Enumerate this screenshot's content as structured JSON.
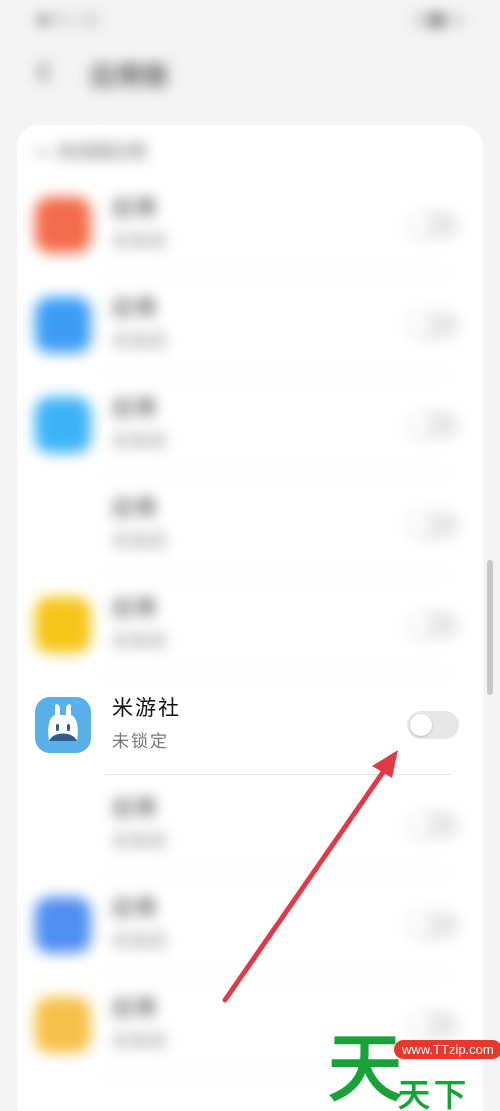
{
  "statusbar": {
    "left_text": "▪ ≈ ◌ ▯",
    "right_text": "▯ ▮▮ ▭"
  },
  "header": {
    "title": "应用锁"
  },
  "section": {
    "label": "← 未加锁应用"
  },
  "apps": [
    {
      "name": "应用",
      "status": "未锁定",
      "color": "#f36b4a",
      "icon": "app-icon",
      "blurred": true
    },
    {
      "name": "应用",
      "status": "未锁定",
      "color": "#3d9df6",
      "icon": "app-icon",
      "blurred": true
    },
    {
      "name": "应用",
      "status": "未锁定",
      "color": "#3db3f7",
      "icon": "app-icon",
      "blurred": true
    },
    {
      "name": "应用",
      "status": "未锁定",
      "color": "#ffffff",
      "icon": "app-icon",
      "blurred": true
    },
    {
      "name": "应用",
      "status": "未锁定",
      "color": "#f5c518",
      "icon": "app-icon",
      "blurred": true
    },
    {
      "name": "米游社",
      "status": "未锁定",
      "color": "#5ab0e9",
      "icon": "miyoushe-icon",
      "blurred": false
    },
    {
      "name": "应用",
      "status": "未锁定",
      "color": "#ffffff",
      "icon": "app-icon",
      "blurred": true
    },
    {
      "name": "应用",
      "status": "未锁定",
      "color": "#4f8ef2",
      "icon": "app-icon",
      "blurred": true
    },
    {
      "name": "应用",
      "status": "未锁定",
      "color": "#f7c04a",
      "icon": "app-icon",
      "blurred": true
    }
  ],
  "watermark": {
    "big_char": "天",
    "url": "www.TTzip.com",
    "small_text": "天下载"
  },
  "colors": {
    "annotation_arrow": "#e03a46",
    "toggle_off": "#e7e7e7",
    "watermark_green": "#1aa23a",
    "watermark_red": "#e8382c"
  }
}
